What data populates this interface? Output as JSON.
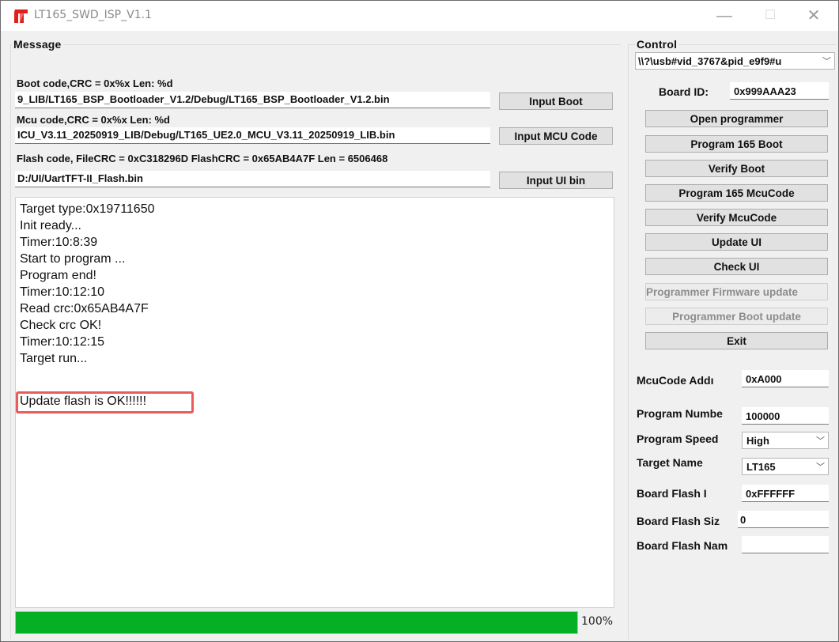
{
  "window": {
    "title": "LT165_SWD_ISP_V1.1",
    "minimize": "—",
    "maximize": "☐",
    "close": "✕"
  },
  "message": {
    "group_label": "Message",
    "boot_info": "Boot code,CRC = 0x%x  Len: %d",
    "boot_path": "9_LIB/LT165_BSP_Bootloader_V1.2/Debug/LT165_BSP_Bootloader_V1.2.bin",
    "boot_button": "Input Boot",
    "mcu_info": "Mcu code,CRC = 0x%x  Len: %d",
    "mcu_path": "ICU_V3.11_20250919_LIB/Debug/LT165_UE2.0_MCU_V3.11_20250919_LIB.bin",
    "mcu_button": "Input MCU Code",
    "flash_info": "Flash code, FileCRC = 0xC318296D  FlashCRC = 0x65AB4A7F  Len = 6506468",
    "flash_path": "D:/UI/UartTFT-II_Flash.bin",
    "flash_button": "Input UI bin"
  },
  "log": {
    "lines": [
      "Target type:0x19711650",
      "Init ready...",
      "Timer:10:8:39",
      "Start to program ...",
      "Program end!",
      "Timer:10:12:10",
      "Read crc:0x65AB4A7F",
      "Check crc OK!",
      "Timer:10:12:15",
      "Target run..."
    ],
    "result": "Update flash is OK!!!!!!",
    "highlight_color": "#ea5b5b"
  },
  "progress": {
    "value": 1.0,
    "label": "100%",
    "color": "#06b025"
  },
  "control": {
    "group_label": "Control",
    "device_select": "\\\\?\\usb#vid_3767&pid_e9f9#u",
    "board_id_label": "Board ID:",
    "board_id_value": "0x999AAA23",
    "buttons": {
      "open_programmer": "Open programmer",
      "program_boot": "Program 165 Boot",
      "verify_boot": "Verify Boot",
      "program_mcu": "Program 165 McuCode",
      "verify_mcu": "Verify McuCode",
      "update_ui": "Update UI",
      "check_ui": "Check UI",
      "fw_update": "Programmer Firmware update",
      "boot_update": "Programmer Boot update",
      "exit": "Exit"
    }
  },
  "params": {
    "mcu_addr_label": "McuCode Addı",
    "mcu_addr_value": "0xA000",
    "program_number_label": "Program Numbe",
    "program_number_value": "100000",
    "program_speed_label": "Program Speed",
    "program_speed_value": "High",
    "target_name_label": "Target Name",
    "target_name_value": "LT165",
    "board_flash_id_label": "Board Flash I",
    "board_flash_id_value": "0xFFFFFF",
    "board_flash_size_label": "Board Flash Siz",
    "board_flash_size_value": "0",
    "board_flash_name_label": "Board Flash Nam",
    "board_flash_name_value": ""
  }
}
